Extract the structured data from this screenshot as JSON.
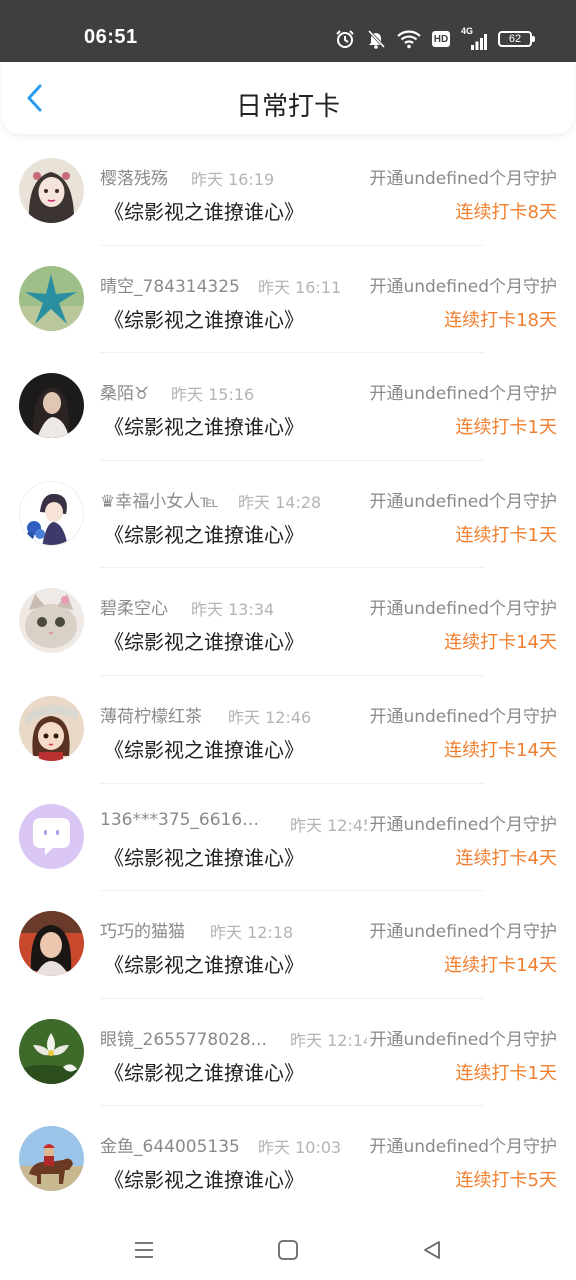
{
  "status_bar": {
    "time": "06:51",
    "hd_label": "HD",
    "network_label": "4G",
    "battery_level": "62",
    "icons": [
      "alarm-icon",
      "mute-bell-icon",
      "wifi-icon",
      "hd-icon",
      "signal-icon",
      "battery-icon"
    ]
  },
  "header": {
    "title": "日常打卡",
    "back_icon": "chevron-left-icon",
    "accent": "#2a9bf0"
  },
  "colors": {
    "streak": "#f07f2f",
    "name": "#8a8a8a",
    "time": "#b4b4b4",
    "status_bar_bg": "#3f3f3f"
  },
  "checkins": [
    {
      "name": "樱落残殇",
      "time": "昨天 16:19",
      "guard_text": "开通undefined个月守护",
      "work_title": "《综影视之谁撩谁心》",
      "streak_text": "连续打卡8天",
      "avatar": "avatar-girl-ink"
    },
    {
      "name": "晴空_784314325",
      "time": "昨天 16:11",
      "guard_text": "开通undefined个月守护",
      "work_title": "《综影视之谁撩谁心》",
      "streak_text": "连续打卡18天",
      "avatar": "avatar-starfish"
    },
    {
      "name": "桑陌♉",
      "time": "昨天 15:16",
      "guard_text": "开通undefined个月守护",
      "work_title": "《综影视之谁撩谁心》",
      "streak_text": "连续打卡1天",
      "avatar": "avatar-photo-girl"
    },
    {
      "name": "♛幸福小女人℡",
      "time": "昨天 14:28",
      "guard_text": "开通undefined个月守护",
      "work_title": "《综影视之谁撩谁心》",
      "streak_text": "连续打卡1天",
      "avatar": "avatar-anime-boy"
    },
    {
      "name": "碧柔空心",
      "time": "昨天 13:34",
      "guard_text": "开通undefined个月守护",
      "work_title": "《综影视之谁撩谁心》",
      "streak_text": "连续打卡14天",
      "avatar": "avatar-cat"
    },
    {
      "name": "薄荷柠檬红茶",
      "time": "昨天 12:46",
      "guard_text": "开通undefined个月守护",
      "work_title": "《综影视之谁撩谁心》",
      "streak_text": "连续打卡14天",
      "avatar": "avatar-cartoon-girl"
    },
    {
      "name": "136***375_66163...",
      "time": "昨天 12:45",
      "guard_text": "开通undefined个月守护",
      "work_title": "《综影视之谁撩谁心》",
      "streak_text": "连续打卡4天",
      "avatar": "avatar-default-chat"
    },
    {
      "name": "巧巧的猫猫",
      "time": "昨天 12:18",
      "guard_text": "开通undefined个月守护",
      "work_title": "《综影视之谁撩谁心》",
      "streak_text": "连续打卡14天",
      "avatar": "avatar-photo-woman"
    },
    {
      "name": "眼镜_2655778028...",
      "time": "昨天 12:14",
      "guard_text": "开通undefined个月守护",
      "work_title": "《综影视之谁撩谁心》",
      "streak_text": "连续打卡1天",
      "avatar": "avatar-lotus"
    },
    {
      "name": "金鱼_644005135",
      "time": "昨天 10:03",
      "guard_text": "开通undefined个月守护",
      "work_title": "《综影视之谁撩谁心》",
      "streak_text": "连续打卡5天",
      "avatar": "avatar-horse-rider"
    }
  ],
  "nav_bar": {
    "buttons": [
      "menu-icon",
      "home-square-icon",
      "back-triangle-icon"
    ]
  }
}
